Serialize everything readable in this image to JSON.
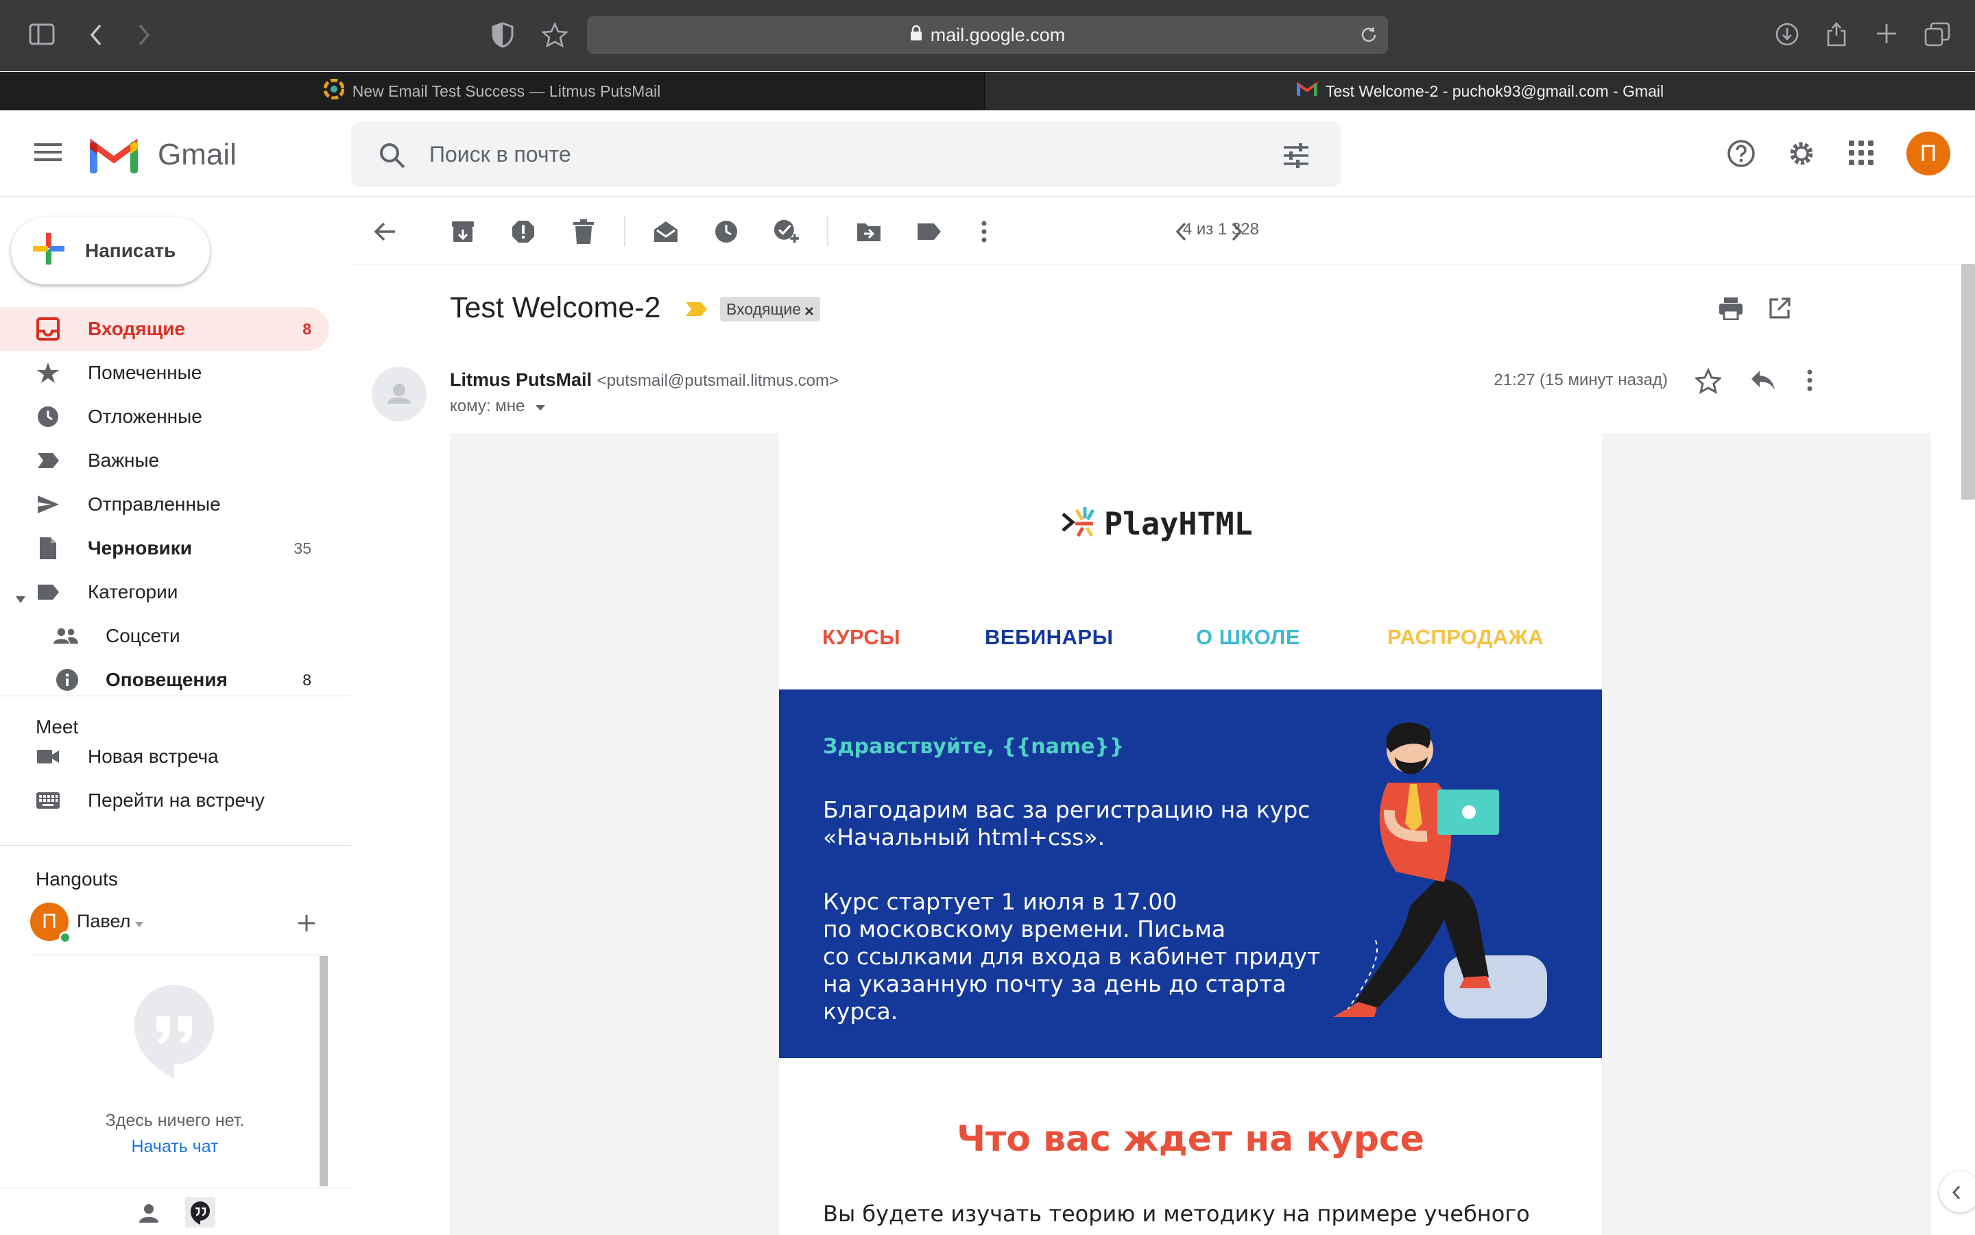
{
  "browser": {
    "url": "mail.google.com",
    "tabs": [
      {
        "title": "New Email Test Success — Litmus PutsMail"
      },
      {
        "title": "Test Welcome-2 - puchok93@gmail.com - Gmail"
      }
    ]
  },
  "header": {
    "app_name": "Gmail",
    "search_placeholder": "Поиск в почте",
    "avatar_letter": "П"
  },
  "sidebar": {
    "compose_label": "Написать",
    "items": [
      {
        "label": "Входящие",
        "count": "8",
        "icon": "inbox-icon"
      },
      {
        "label": "Помеченные",
        "count": "",
        "icon": "star-icon"
      },
      {
        "label": "Отложенные",
        "count": "",
        "icon": "clock-icon"
      },
      {
        "label": "Важные",
        "count": "",
        "icon": "important-icon"
      },
      {
        "label": "Отправленные",
        "count": "",
        "icon": "send-icon"
      },
      {
        "label": "Черновики",
        "count": "35",
        "icon": "draft-icon"
      },
      {
        "label": "Категории",
        "count": "",
        "icon": "label-icon"
      },
      {
        "label": "Соцсети",
        "count": "",
        "icon": "people-icon"
      },
      {
        "label": "Оповещения",
        "count": "8",
        "icon": "info-icon"
      }
    ],
    "meet": {
      "title": "Meet",
      "new_meeting": "Новая встреча",
      "join_meeting": "Перейти на встречу"
    },
    "hangouts": {
      "title": "Hangouts",
      "user_name": "Павел",
      "user_initial": "П",
      "empty_text": "Здесь ничего нет.",
      "start_chat": "Начать чат"
    }
  },
  "toolbar": {
    "pagination": "4 из 1 328"
  },
  "message": {
    "subject": "Test Welcome-2",
    "label_chip": "Входящие",
    "sender_name": "Litmus PutsMail",
    "sender_email": "<putsmail@putsmail.litmus.com>",
    "recipient": "кому: мне",
    "time": "21:27 (15 минут назад)"
  },
  "email": {
    "logo_text": "PlayHTML",
    "menu": [
      {
        "label": "КУРСЫ",
        "color": "#e8503a"
      },
      {
        "label": "ВЕБИНАРЫ",
        "color": "#15399a"
      },
      {
        "label": "О ШКОЛЕ",
        "color": "#3dbad0"
      },
      {
        "label": "РАСПРОДАЖА",
        "color": "#f5c242"
      }
    ],
    "greeting": "Здравствуйте, {{name}}",
    "paragraph1_line1": "Благодарим вас за регистрацию на курс",
    "paragraph1_line2": "«Начальный html+css».",
    "paragraph2_lines": [
      "Курс стартует 1 июля в 17.00",
      "по московскому времени. Письма",
      "со ссылками для входа в кабинет придут",
      "на указанную почту за день до старта",
      "курса."
    ],
    "section_title": "Что вас ждет на курсе",
    "body_text": "Вы будете изучать теорию и методику на примере учебного"
  },
  "colors": {
    "hero_bg": "#15399a",
    "greeting": "#4fd1c5",
    "accent_red": "#e8503a",
    "inbox_active_bg": "#fce8e6"
  }
}
